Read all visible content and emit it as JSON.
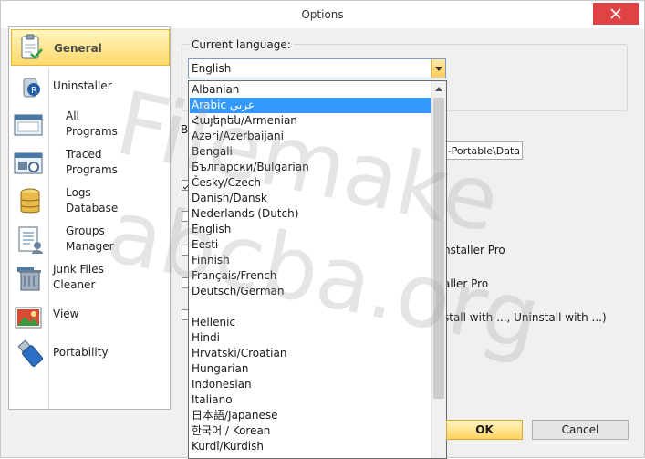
{
  "window": {
    "title": "Options"
  },
  "sidebar": {
    "items": [
      {
        "label": "General"
      },
      {
        "label": "Uninstaller"
      },
      {
        "label": "All\nPrograms"
      },
      {
        "label": "Traced\nPrograms"
      },
      {
        "label": "Logs\nDatabase"
      },
      {
        "label": "Groups\nManager"
      },
      {
        "label": "Junk Files\nCleaner"
      },
      {
        "label": "View"
      },
      {
        "label": "Portability"
      }
    ]
  },
  "language": {
    "label": "Current language:",
    "value": "English",
    "options": [
      "Albanian",
      "Arabic عربي",
      "Հայերեն/Armenian",
      "Azəri/Azerbaijani",
      "Bengali",
      "Български/Bulgarian",
      "Česky/Czech",
      "Danish/Dansk",
      "Nederlands (Dutch)",
      "English",
      "Eesti",
      "Finnish",
      "Français/French",
      "Deutsch/German",
      "",
      "Hellenic",
      "Hindi",
      "Hrvatski/Croatian",
      "Hungarian",
      "Indonesian",
      "Italiano",
      "日本語/Japanese",
      "한국어 / Korean",
      "Kurdî/Kurdish"
    ],
    "selected_index": 1
  },
  "background": {
    "b_label": "B",
    "path_text": "-Portable\\Data",
    "line1": "nstaller Pro",
    "line2": "aller Pro",
    "line3": "stall with ..., Uninstall with ...)"
  },
  "buttons": {
    "ok": "OK",
    "cancel": "Cancel"
  },
  "watermark": {
    "line1": "Filemake",
    "line2": "abcba.org"
  }
}
